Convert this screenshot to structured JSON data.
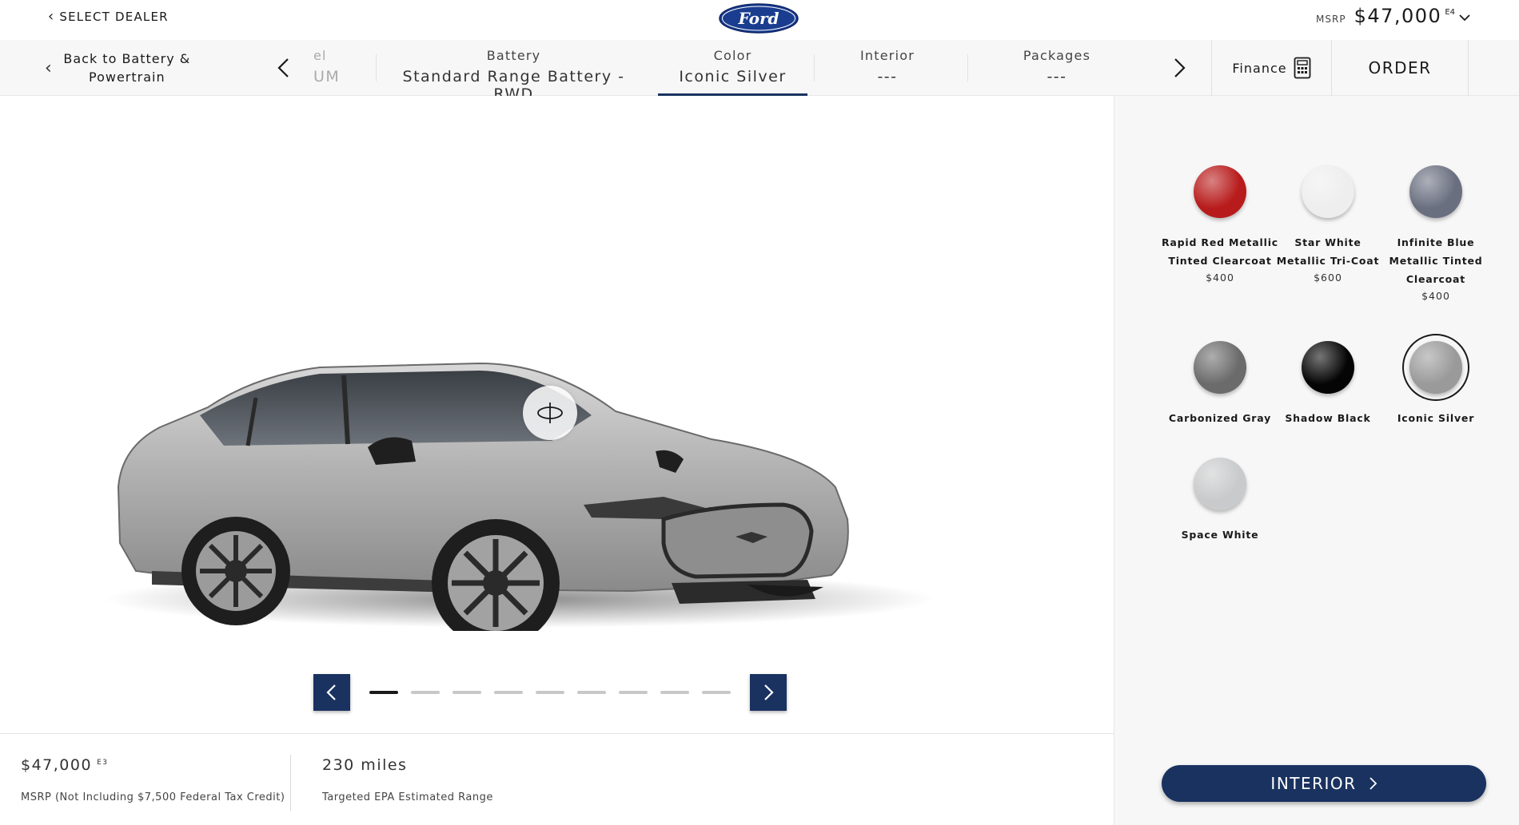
{
  "header": {
    "select_dealer": "SELECT DEALER",
    "msrp_label": "MSRP",
    "msrp_price": "$47,000",
    "msrp_footnote": "E4"
  },
  "stepnav": {
    "back_label": "Back to Battery & Powertrain",
    "partial_step": {
      "label": "el",
      "value": "UM"
    },
    "steps": [
      {
        "label": "Battery",
        "value": "Standard Range Battery - RWD"
      },
      {
        "label": "Color",
        "value": "Iconic Silver"
      },
      {
        "label": "Interior",
        "value": "---"
      },
      {
        "label": "Packages",
        "value": "---"
      }
    ],
    "active_step": "Color",
    "finance_label": "Finance",
    "order_label": "ORDER"
  },
  "viewer": {
    "carousel_total": 9,
    "carousel_active": 1
  },
  "summary": {
    "price": "$47,000",
    "price_footnote": "E3",
    "price_caption": "MSRP (Not Including $7,500 Federal Tax Credit)",
    "range": "230 miles",
    "range_caption": "Targeted EPA Estimated Range"
  },
  "colors": [
    {
      "name": "Rapid Red Metallic Tinted Clearcoat",
      "price": "$400",
      "hex": "#b81b1b",
      "selected": false
    },
    {
      "name": "Star White Metallic Tri-Coat",
      "price": "$600",
      "hex": "#eeeeee",
      "selected": false
    },
    {
      "name": "Infinite Blue Metallic Tinted Clearcoat",
      "price": "$400",
      "hex": "#6a6f80",
      "selected": false
    },
    {
      "name": "Carbonized Gray",
      "price": "",
      "hex": "#6b6b6b",
      "selected": false
    },
    {
      "name": "Shadow Black",
      "price": "",
      "hex": "#050505",
      "selected": false
    },
    {
      "name": "Iconic Silver",
      "price": "",
      "hex": "#9a9a9a",
      "selected": true
    },
    {
      "name": "Space White",
      "price": "",
      "hex": "#c9cacb",
      "selected": false
    }
  ],
  "cta": {
    "label": "INTERIOR"
  },
  "brand": {
    "accent": "#1a3260",
    "logo_text": "Ford"
  }
}
